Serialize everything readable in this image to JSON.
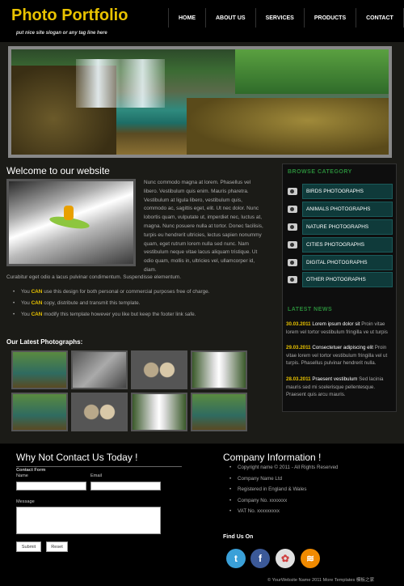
{
  "header": {
    "logo": "Photo Portfolio",
    "tagline": "put nice site slogan or any tag line here",
    "nav": [
      "HOME",
      "ABOUT US",
      "SERVICES",
      "PRODUCTS",
      "CONTACT"
    ]
  },
  "main": {
    "welcome_title": "Welcome to our website",
    "intro_right": "Nunc commodo magna at lorem. Phasellus vel libero. Vestibulum quis enim. Mauris pharetra. Vestibulum at ligula libero, vestibulum quis, commodo ac, sagittis eget, elit. Ut nec dolor. Nunc lobortis quam, vulputate ut, imperdiet nec, luctus at, magna. Nunc posuere nulla at tortor. Donec facilisis, turpis eu hendrerit ultricies, lectus sapien nonummy quam, eget rutrum lorem nulla sed nunc. Nam vestibulum neque vitae lacus aliquam tristique. Ut odio quam, mollis in, ultricies vel, ullamcorper id, diam.",
    "intro_bottom": "Curabitur eget odio a lacus pulvinar condimentum. Suspendisse elementum.",
    "bullets": [
      {
        "pre": "You ",
        "strong": "CAN",
        "post": " use this design for both personal or commercial purposes free of charge."
      },
      {
        "pre": "You ",
        "strong": "CAN",
        "post": " copy, distribute and transmit this template."
      },
      {
        "pre": "You ",
        "strong": "CAN",
        "post": " modify this template however you like but keep the footer link safe."
      }
    ],
    "latest_title": "Our Latest Photographs:",
    "thumbs": [
      "green",
      "grey",
      "cat",
      "falls",
      "green",
      "cat",
      "falls",
      "green"
    ]
  },
  "sidebar": {
    "browse_title": "BROWSE CATEGORY",
    "categories": [
      "BIRDS PHOTOGRAPHS",
      "ANIMALS PHOTOGRAPHS",
      "NATURE PHOTOGRAPHS",
      "CITIES PHOTOGRAPHS",
      "DIGITAL PHOTOGRAPHS",
      "OTHER PHOTOGRAPHS"
    ],
    "news_title": "LATEST NEWS",
    "news": [
      {
        "date": "30.03.2011",
        "head": " Lorem ipsum dolor sit",
        "body": " Proin vitae lorem vel tortor vestibulum fringilla ve ut turpis"
      },
      {
        "date": "29.03.2011",
        "head": " Consectetuer adipiscing elit",
        "body": " Proin vitae lorem vel tortor vestibulum fringilla vel ut turpis. Phasellus pulvinar hendrerit nulla."
      },
      {
        "date": "28.03.2011",
        "head": " Praesent vestibulum",
        "body": " Sed lacinia mauris sed mi scelerisque pellentesque. Praesent quis arcu mauris."
      }
    ]
  },
  "contact": {
    "title": "Why Not Contact Us Today !",
    "form_title": "Contact Form",
    "name_label": "Name",
    "email_label": "Email",
    "message_label": "Message",
    "submit": "Submit",
    "reset": "Reset"
  },
  "company": {
    "title": "Company Information !",
    "items": [
      "Copyright name © 2011 - All Rights Reserved",
      "Company Name Ltd",
      "Registered in England & Wales",
      "Company No. xxxxxxx",
      "VAT No. xxxxxxxxx"
    ],
    "find_us": "Find Us On",
    "social": [
      {
        "name": "twitter",
        "glyph": "t",
        "color": "#3aa0d8"
      },
      {
        "name": "facebook",
        "glyph": "f",
        "color": "#3b5998"
      },
      {
        "name": "picasa",
        "glyph": "✿",
        "color": "#e0e0e0"
      },
      {
        "name": "rss",
        "glyph": "≋",
        "color": "#f08a00"
      }
    ]
  },
  "footer": {
    "copyright": "© YourWebsite Name 2011 More Templates 模板之家"
  }
}
